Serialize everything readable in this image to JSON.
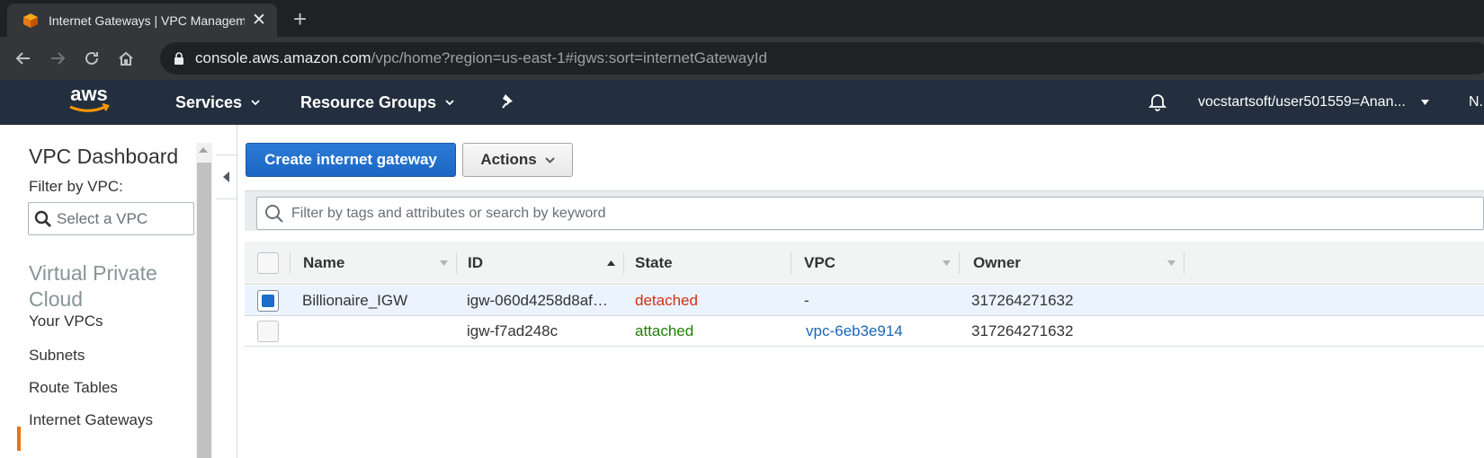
{
  "browser": {
    "tab_title": "Internet Gateways | VPC Management Console",
    "url_host": "console.aws.amazon.com",
    "url_path": "/vpc/home?region=us-east-1#igws:sort=internetGatewayId"
  },
  "aws_nav": {
    "logo_text": "aws",
    "services": "Services",
    "resource_groups": "Resource Groups",
    "user": "vocstartsoft/user501559=Anan...",
    "region": "N."
  },
  "sidebar": {
    "title": "VPC Dashboard",
    "filter_label": "Filter by VPC:",
    "select_placeholder": "Select a VPC",
    "section": "Virtual Private Cloud",
    "items": [
      {
        "label": "Your VPCs"
      },
      {
        "label": "Subnets"
      },
      {
        "label": "Route Tables"
      },
      {
        "label": "Internet Gateways",
        "active": true
      }
    ]
  },
  "main": {
    "create_button": "Create internet gateway",
    "actions_button": "Actions",
    "filter_placeholder": "Filter by tags and attributes or search by keyword",
    "columns": {
      "name": "Name",
      "id": "ID",
      "state": "State",
      "vpc": "VPC",
      "owner": "Owner"
    },
    "rows": [
      {
        "selected": true,
        "name": "Billionaire_IGW",
        "id": "igw-060d4258d8af…",
        "state": "detached",
        "vpc": "-",
        "owner": "317264271632"
      },
      {
        "selected": false,
        "name": "",
        "id": "igw-f7ad248c",
        "state": "attached",
        "vpc": "vpc-6eb3e914",
        "owner": "317264271632"
      }
    ]
  },
  "colors": {
    "aws_nav_bg": "#232f3e",
    "primary_button": "#1c66c4",
    "detached": "#d13212",
    "attached": "#1d8102",
    "link": "#1b66b7",
    "active_indicator": "#ec7211"
  }
}
